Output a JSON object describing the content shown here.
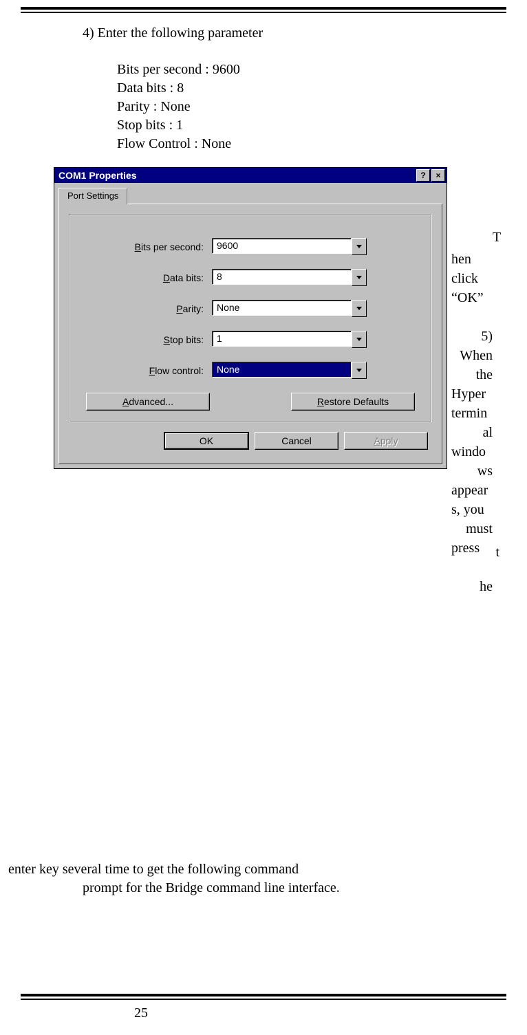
{
  "instructions": {
    "step4": "4)  Enter the following parameter",
    "params": {
      "p1": "Bits per second : 9600",
      "p2": "Data bits : 8",
      "p3": "Parity : None",
      "p4": "Stop bits : 1",
      "p5": "Flow Control : None"
    }
  },
  "dialog": {
    "title": "COM1 Properties",
    "help_btn": "?",
    "close_btn": "×",
    "tab": "Port Settings",
    "fields": {
      "bits_label_pre": "B",
      "bits_label_post": "its per second:",
      "bits_value": "9600",
      "databits_label_pre": "D",
      "databits_label_post": "ata bits:",
      "databits_value": "8",
      "parity_label_pre": "P",
      "parity_label_post": "arity:",
      "parity_value": "None",
      "stopbits_label_pre": "S",
      "stopbits_label_post": "top bits:",
      "stopbits_value": "1",
      "flow_label_pre": "F",
      "flow_label_post": "low control:",
      "flow_value": "None"
    },
    "buttons": {
      "advanced_pre": "A",
      "advanced_post": "dvanced...",
      "restore_pre": "R",
      "restore_post": "estore Defaults",
      "ok": "OK",
      "cancel": "Cancel",
      "apply_pre": "A",
      "apply_post": "pply"
    }
  },
  "wrap_text": {
    "far1": "T",
    "s1": "hen",
    "s2": "click",
    "s3": "“OK”",
    "blank": " ",
    "s4": "5)",
    "s5": "When",
    "s6": "the",
    "s7": "Hyper",
    "s8": "termin",
    "s9": "al",
    "s10": "windo",
    "s11": "ws",
    "s12": "appear",
    "s13": "s,  you",
    "s14": "must",
    "s15": "press",
    "far2": "t",
    "s16": "he"
  },
  "below": {
    "line1": "enter key several time to get the following command",
    "line2": "prompt for the Bridge command line interface."
  },
  "page_number": "25"
}
